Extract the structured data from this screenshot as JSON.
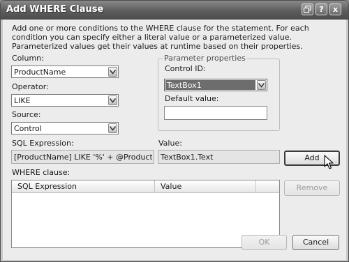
{
  "window": {
    "title": "Add WHERE Clause",
    "buttons": {
      "restore_icon": "restore-icon",
      "help_label": "?",
      "close_label": "x"
    }
  },
  "description": "Add one or more conditions to the WHERE clause for the statement. For each condition you can specify either a literal value or a parameterized value. Parameterized values get their values at runtime based on their properties.",
  "column": {
    "label": "Column:",
    "value": "ProductName"
  },
  "operator": {
    "label": "Operator:",
    "value": "LIKE"
  },
  "source": {
    "label": "Source:",
    "value": "Control"
  },
  "parameter_properties": {
    "legend": "Parameter properties",
    "control_id": {
      "label": "Control ID:",
      "value": "TextBox1"
    },
    "default_value": {
      "label": "Default value:",
      "value": ""
    }
  },
  "sql_expression": {
    "label": "SQL Expression:",
    "value": "[ProductName] LIKE '%' + @ProductName + '"
  },
  "value": {
    "label": "Value:",
    "value": "TextBox1.Text"
  },
  "add_button": "Add",
  "where_clause": {
    "label": "WHERE clause:",
    "columns": [
      "SQL Expression",
      "Value"
    ],
    "rows": []
  },
  "remove_button": "Remove",
  "ok_button": "OK",
  "cancel_button": "Cancel",
  "colors": {
    "selection": "#6d6d6d",
    "titlebar": "#5d5d5d"
  }
}
